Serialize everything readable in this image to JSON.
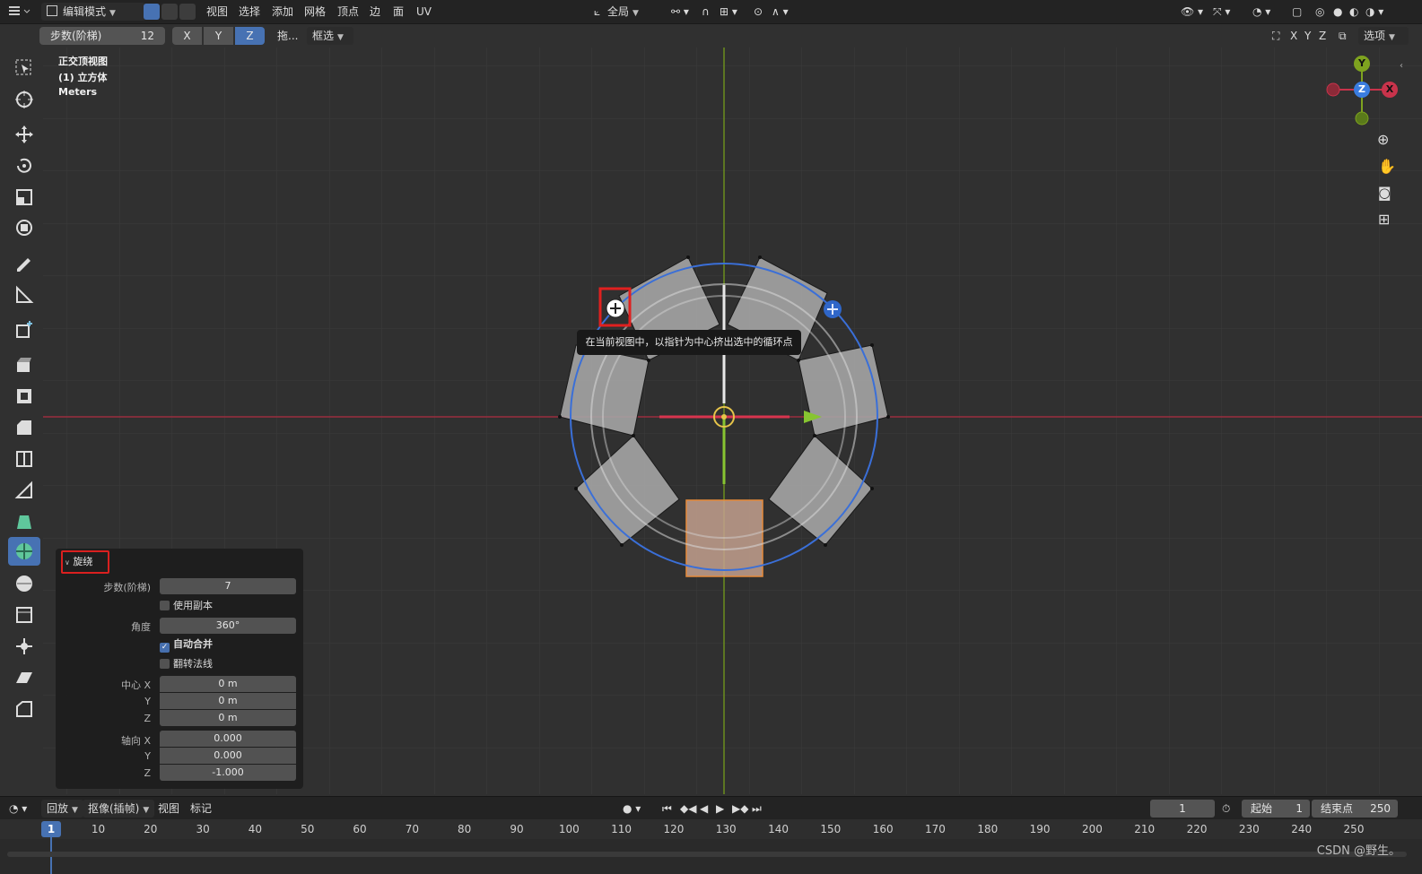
{
  "header": {
    "mode_label": "编辑模式",
    "menu": [
      "视图",
      "选择",
      "添加",
      "网格",
      "顶点",
      "边",
      "面",
      "UV"
    ],
    "transform_orientation": "全局"
  },
  "tool_options": {
    "steps_label": "步数(阶梯)",
    "steps_value": "12",
    "axis_x": "X",
    "axis_y": "Y",
    "axis_z": "Z",
    "drag_label": "拖...",
    "select_mode": "框选",
    "right_axes": [
      "X",
      "Y",
      "Z"
    ],
    "options_label": "选项"
  },
  "viewport": {
    "view_name": "正交顶视图",
    "object_name": "(1) 立方体",
    "units": "Meters",
    "tooltip": "在当前视图中，以指针为中心挤出选中的循环点",
    "gizmo": {
      "y": "Y",
      "z": "Z",
      "x": "X"
    }
  },
  "operator_panel": {
    "title": "旋绕",
    "steps_label": "步数(阶梯)",
    "steps_value": "7",
    "use_duplicates_label": "使用副本",
    "use_duplicates": false,
    "angle_label": "角度",
    "angle_value": "360°",
    "auto_merge_label": "自动合并",
    "auto_merge": true,
    "flip_normals_label": "翻转法线",
    "flip_normals": false,
    "center_x_label": "中心 X",
    "center_x": "0 m",
    "center_y_label": "Y",
    "center_y": "0 m",
    "center_z_label": "Z",
    "center_z": "0 m",
    "axis_x_label": "轴向 X",
    "axis_x": "0.000",
    "axis_y_label": "Y",
    "axis_y": "0.000",
    "axis_z_label": "Z",
    "axis_z": "-1.000"
  },
  "timeline": {
    "playback_label": "回放",
    "keying_label": "抠像(插帧)",
    "view_label": "视图",
    "marker_label": "标记",
    "current_frame": "1",
    "start_label": "起始",
    "start_value": "1",
    "end_label": "结束点",
    "end_value": "250",
    "ticks": [
      "1",
      "10",
      "20",
      "30",
      "40",
      "50",
      "60",
      "70",
      "80",
      "90",
      "100",
      "110",
      "120",
      "130",
      "140",
      "150",
      "160",
      "170",
      "180",
      "190",
      "200",
      "210",
      "220",
      "230",
      "240",
      "250"
    ]
  },
  "watermark": "CSDN @野生。",
  "colors": {
    "accent": "#4772b3",
    "x_axis": "#c8334b",
    "y_axis": "#7ea31f",
    "highlight_box": "#e0201f",
    "selected_face": "#c3a08e"
  }
}
